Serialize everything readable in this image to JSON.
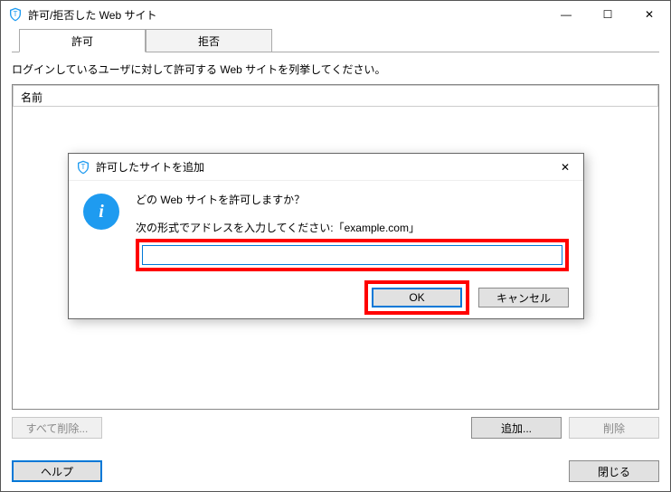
{
  "window": {
    "title": "許可/拒否した Web サイト",
    "minimize": "—",
    "maximize": "☐",
    "close": "✕"
  },
  "tabs": {
    "allow": "許可",
    "deny": "拒否"
  },
  "instruction": "ログインしているユーザに対して許可する Web サイトを列挙してください。",
  "list": {
    "header_name": "名前"
  },
  "buttons": {
    "remove_all": "すべて削除...",
    "add": "追加...",
    "remove": "削除",
    "help": "ヘルプ",
    "close": "閉じる"
  },
  "dialog": {
    "title": "許可したサイトを追加",
    "close": "✕",
    "question": "どの Web サイトを許可しますか？",
    "hint": "次の形式でアドレスを入力してください:「example.com」",
    "input_value": "",
    "ok": "OK",
    "cancel": "キャンセル"
  }
}
